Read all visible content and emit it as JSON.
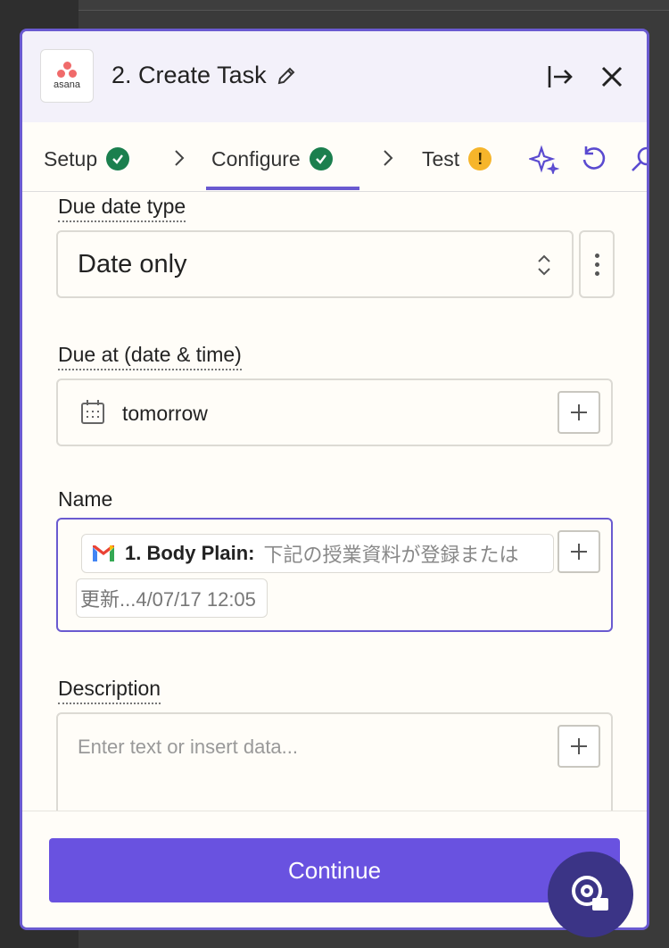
{
  "app": {
    "brand": "asana"
  },
  "header": {
    "title": "2. Create Task"
  },
  "tabs": [
    {
      "label": "Setup",
      "status": "complete"
    },
    {
      "label": "Configure",
      "status": "complete",
      "active": true
    },
    {
      "label": "Test",
      "status": "warning",
      "badge": "!"
    }
  ],
  "tools": [
    "sparkle-icon",
    "refresh-icon",
    "search-icon"
  ],
  "fields": {
    "due_date_type": {
      "label": "Due date type",
      "value": "Date only"
    },
    "due_at": {
      "label": "Due at (date & time)",
      "value": "tomorrow"
    },
    "name": {
      "label": "Name",
      "pill_key": "1. Body Plain:",
      "pill_value": "下記の授業資料が登録または",
      "pill_continuation": "更新...4/07/17 12:05"
    },
    "description": {
      "label": "Description",
      "placeholder": "Enter text or insert data..."
    }
  },
  "footer": {
    "continue_label": "Continue"
  },
  "colors": {
    "accent": "#6a5ad0",
    "button": "#6952e0",
    "success": "#1b7f4e",
    "warning": "#f6b52b",
    "asana": "#f06a6a"
  }
}
